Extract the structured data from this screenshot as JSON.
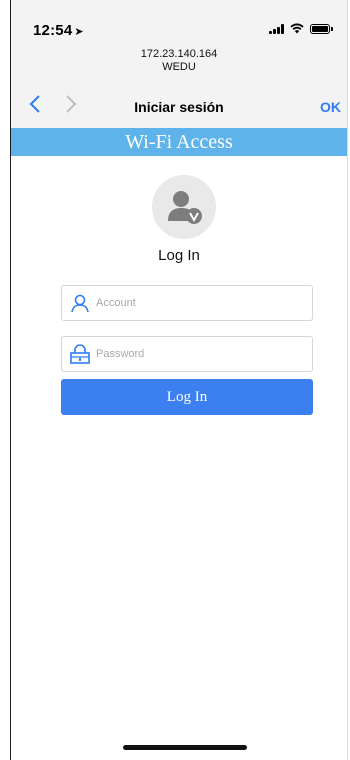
{
  "status_bar": {
    "time": "12:54",
    "location_arrow": "location-arrow-icon"
  },
  "browser": {
    "address": "172.23.140.164",
    "site_name": "WEDU",
    "back_icon": "chevron-left-icon",
    "forward_icon": "chevron-right-icon",
    "page_title": "Iniciar sesión",
    "ok_label": "OK"
  },
  "page": {
    "banner_title": "Wi-Fi Access",
    "heading": "Log In",
    "account_placeholder": "Account",
    "password_placeholder": "Password",
    "login_button": "Log In"
  },
  "colors": {
    "banner": "#5eb4ea",
    "button": "#3b7ff0",
    "accent": "#2e7cf6"
  }
}
